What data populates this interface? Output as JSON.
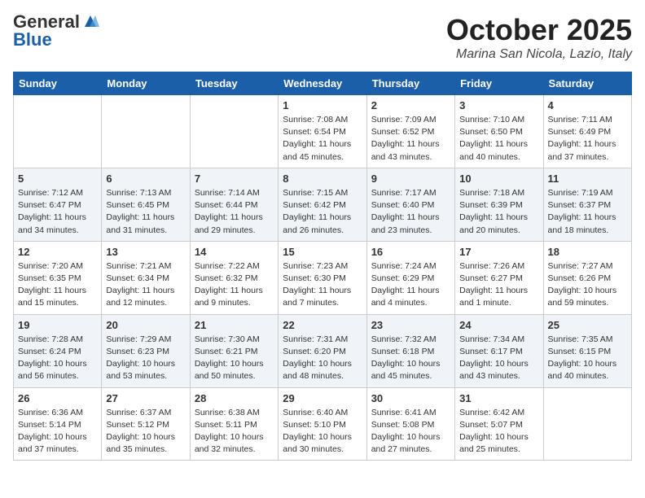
{
  "header": {
    "logo_general": "General",
    "logo_blue": "Blue",
    "month_title": "October 2025",
    "location": "Marina San Nicola, Lazio, Italy"
  },
  "weekdays": [
    "Sunday",
    "Monday",
    "Tuesday",
    "Wednesday",
    "Thursday",
    "Friday",
    "Saturday"
  ],
  "weeks": [
    {
      "days": [
        {
          "number": "",
          "info": ""
        },
        {
          "number": "",
          "info": ""
        },
        {
          "number": "",
          "info": ""
        },
        {
          "number": "1",
          "info": "Sunrise: 7:08 AM\nSunset: 6:54 PM\nDaylight: 11 hours and 45 minutes."
        },
        {
          "number": "2",
          "info": "Sunrise: 7:09 AM\nSunset: 6:52 PM\nDaylight: 11 hours and 43 minutes."
        },
        {
          "number": "3",
          "info": "Sunrise: 7:10 AM\nSunset: 6:50 PM\nDaylight: 11 hours and 40 minutes."
        },
        {
          "number": "4",
          "info": "Sunrise: 7:11 AM\nSunset: 6:49 PM\nDaylight: 11 hours and 37 minutes."
        }
      ]
    },
    {
      "days": [
        {
          "number": "5",
          "info": "Sunrise: 7:12 AM\nSunset: 6:47 PM\nDaylight: 11 hours and 34 minutes."
        },
        {
          "number": "6",
          "info": "Sunrise: 7:13 AM\nSunset: 6:45 PM\nDaylight: 11 hours and 31 minutes."
        },
        {
          "number": "7",
          "info": "Sunrise: 7:14 AM\nSunset: 6:44 PM\nDaylight: 11 hours and 29 minutes."
        },
        {
          "number": "8",
          "info": "Sunrise: 7:15 AM\nSunset: 6:42 PM\nDaylight: 11 hours and 26 minutes."
        },
        {
          "number": "9",
          "info": "Sunrise: 7:17 AM\nSunset: 6:40 PM\nDaylight: 11 hours and 23 minutes."
        },
        {
          "number": "10",
          "info": "Sunrise: 7:18 AM\nSunset: 6:39 PM\nDaylight: 11 hours and 20 minutes."
        },
        {
          "number": "11",
          "info": "Sunrise: 7:19 AM\nSunset: 6:37 PM\nDaylight: 11 hours and 18 minutes."
        }
      ]
    },
    {
      "days": [
        {
          "number": "12",
          "info": "Sunrise: 7:20 AM\nSunset: 6:35 PM\nDaylight: 11 hours and 15 minutes."
        },
        {
          "number": "13",
          "info": "Sunrise: 7:21 AM\nSunset: 6:34 PM\nDaylight: 11 hours and 12 minutes."
        },
        {
          "number": "14",
          "info": "Sunrise: 7:22 AM\nSunset: 6:32 PM\nDaylight: 11 hours and 9 minutes."
        },
        {
          "number": "15",
          "info": "Sunrise: 7:23 AM\nSunset: 6:30 PM\nDaylight: 11 hours and 7 minutes."
        },
        {
          "number": "16",
          "info": "Sunrise: 7:24 AM\nSunset: 6:29 PM\nDaylight: 11 hours and 4 minutes."
        },
        {
          "number": "17",
          "info": "Sunrise: 7:26 AM\nSunset: 6:27 PM\nDaylight: 11 hours and 1 minute."
        },
        {
          "number": "18",
          "info": "Sunrise: 7:27 AM\nSunset: 6:26 PM\nDaylight: 10 hours and 59 minutes."
        }
      ]
    },
    {
      "days": [
        {
          "number": "19",
          "info": "Sunrise: 7:28 AM\nSunset: 6:24 PM\nDaylight: 10 hours and 56 minutes."
        },
        {
          "number": "20",
          "info": "Sunrise: 7:29 AM\nSunset: 6:23 PM\nDaylight: 10 hours and 53 minutes."
        },
        {
          "number": "21",
          "info": "Sunrise: 7:30 AM\nSunset: 6:21 PM\nDaylight: 10 hours and 50 minutes."
        },
        {
          "number": "22",
          "info": "Sunrise: 7:31 AM\nSunset: 6:20 PM\nDaylight: 10 hours and 48 minutes."
        },
        {
          "number": "23",
          "info": "Sunrise: 7:32 AM\nSunset: 6:18 PM\nDaylight: 10 hours and 45 minutes."
        },
        {
          "number": "24",
          "info": "Sunrise: 7:34 AM\nSunset: 6:17 PM\nDaylight: 10 hours and 43 minutes."
        },
        {
          "number": "25",
          "info": "Sunrise: 7:35 AM\nSunset: 6:15 PM\nDaylight: 10 hours and 40 minutes."
        }
      ]
    },
    {
      "days": [
        {
          "number": "26",
          "info": "Sunrise: 6:36 AM\nSunset: 5:14 PM\nDaylight: 10 hours and 37 minutes."
        },
        {
          "number": "27",
          "info": "Sunrise: 6:37 AM\nSunset: 5:12 PM\nDaylight: 10 hours and 35 minutes."
        },
        {
          "number": "28",
          "info": "Sunrise: 6:38 AM\nSunset: 5:11 PM\nDaylight: 10 hours and 32 minutes."
        },
        {
          "number": "29",
          "info": "Sunrise: 6:40 AM\nSunset: 5:10 PM\nDaylight: 10 hours and 30 minutes."
        },
        {
          "number": "30",
          "info": "Sunrise: 6:41 AM\nSunset: 5:08 PM\nDaylight: 10 hours and 27 minutes."
        },
        {
          "number": "31",
          "info": "Sunrise: 6:42 AM\nSunset: 5:07 PM\nDaylight: 10 hours and 25 minutes."
        },
        {
          "number": "",
          "info": ""
        }
      ]
    }
  ]
}
